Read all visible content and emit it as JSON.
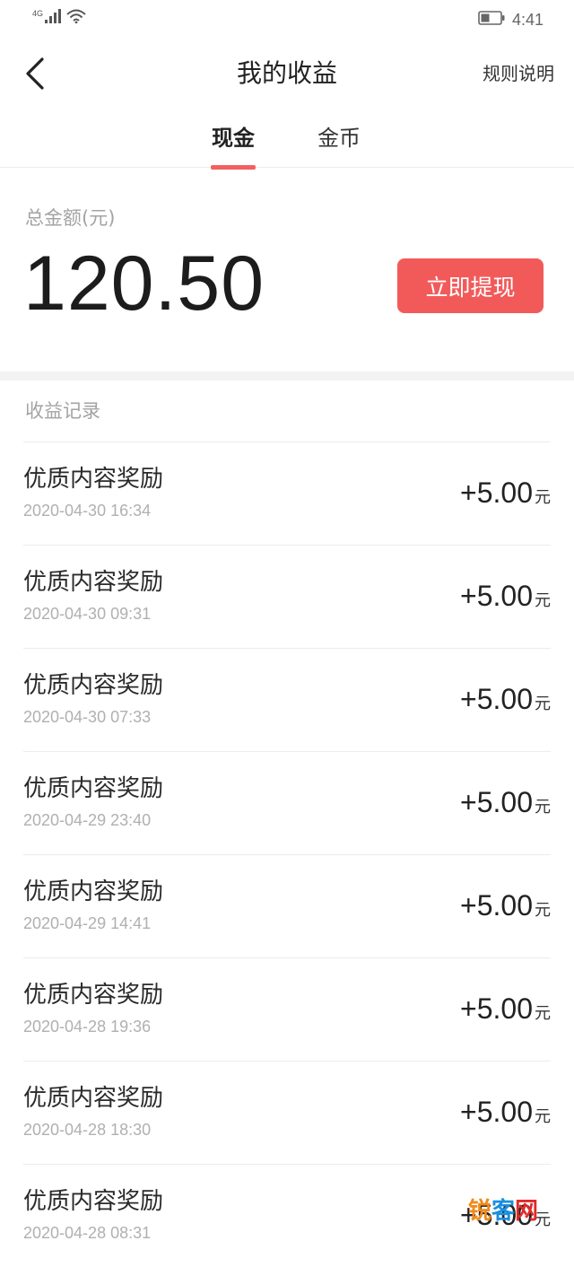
{
  "status_bar": {
    "network": "4G",
    "time": "4:41"
  },
  "nav": {
    "title": "我的收益",
    "rules_label": "规则说明"
  },
  "tabs": [
    {
      "label": "现金",
      "active": true
    },
    {
      "label": "金币",
      "active": false
    }
  ],
  "summary": {
    "label": "总金额(元)",
    "amount": "120.50",
    "withdraw_label": "立即提现"
  },
  "records": {
    "title": "收益记录",
    "unit": "元",
    "items": [
      {
        "title": "优质内容奖励",
        "time": "2020-04-30 16:34",
        "amount": "+5.00"
      },
      {
        "title": "优质内容奖励",
        "time": "2020-04-30 09:31",
        "amount": "+5.00"
      },
      {
        "title": "优质内容奖励",
        "time": "2020-04-30 07:33",
        "amount": "+5.00"
      },
      {
        "title": "优质内容奖励",
        "time": "2020-04-29 23:40",
        "amount": "+5.00"
      },
      {
        "title": "优质内容奖励",
        "time": "2020-04-29 14:41",
        "amount": "+5.00"
      },
      {
        "title": "优质内容奖励",
        "time": "2020-04-28 19:36",
        "amount": "+5.00"
      },
      {
        "title": "优质内容奖励",
        "time": "2020-04-28 18:30",
        "amount": "+5.00"
      },
      {
        "title": "优质内容奖励",
        "time": "2020-04-28 08:31",
        "amount": "+5.00"
      }
    ]
  },
  "watermark": {
    "part1": "锐",
    "part2": "客",
    "part3": "网"
  },
  "colors": {
    "accent": "#f25a5a",
    "muted_text": "#a3a3a3"
  }
}
